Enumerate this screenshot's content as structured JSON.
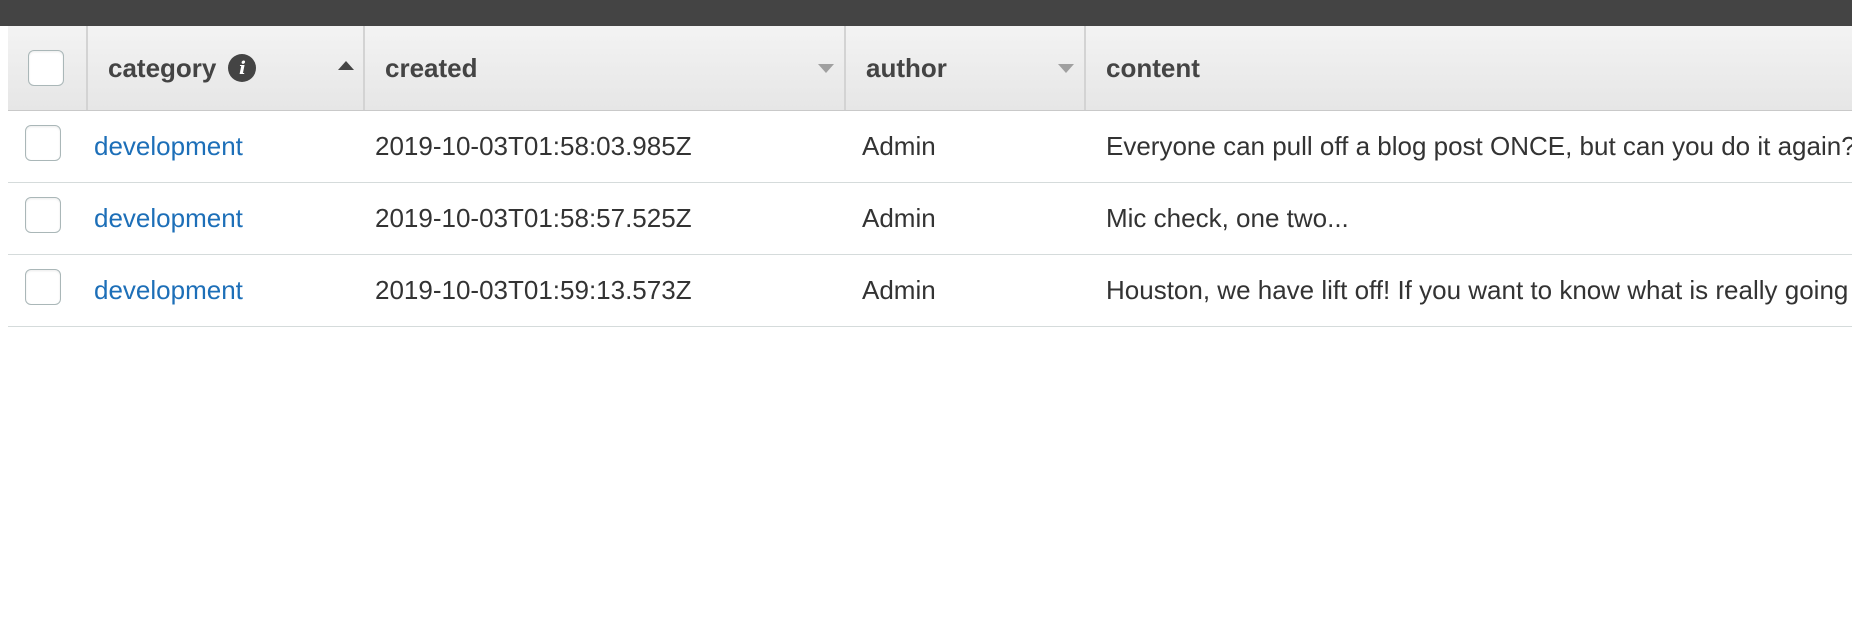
{
  "table": {
    "columns": [
      {
        "key": "select",
        "label": ""
      },
      {
        "key": "category",
        "label": "category",
        "info_icon": "info-icon",
        "sort": "ascending"
      },
      {
        "key": "created",
        "label": "created",
        "sort": "none"
      },
      {
        "key": "author",
        "label": "author",
        "sort": "none"
      },
      {
        "key": "content",
        "label": "content"
      }
    ],
    "rows": [
      {
        "category": "development",
        "created": "2019-10-03T01:58:03.985Z",
        "author": "Admin",
        "content": "Everyone can pull off a blog post ONCE, but can you do it again?"
      },
      {
        "category": "development",
        "created": "2019-10-03T01:58:57.525Z",
        "author": "Admin",
        "content": "Mic check, one two..."
      },
      {
        "category": "development",
        "created": "2019-10-03T01:59:13.573Z",
        "author": "Admin",
        "content": "Houston, we have lift off! If you want to know what is really going on"
      }
    ]
  },
  "colors": {
    "topbar": "#444444",
    "link": "#1d6fb8",
    "header_bg": "#eaeaea"
  }
}
